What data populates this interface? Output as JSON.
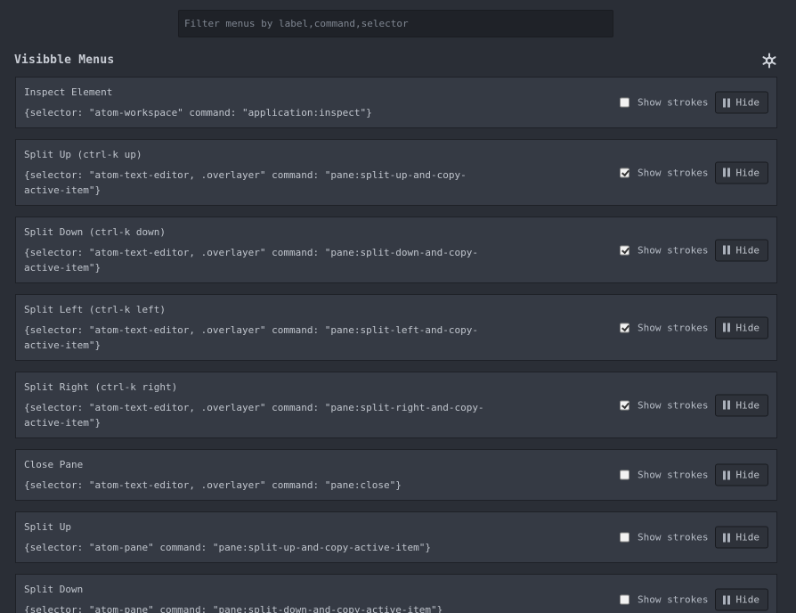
{
  "filter": {
    "placeholder": "Filter menus by label,command,selector",
    "value": ""
  },
  "section": {
    "title": "Visibble Menus",
    "settings_icon": "gear-icon"
  },
  "controls": {
    "show_strokes_label": "Show strokes",
    "hide_label": "Hide",
    "hide_icon": "pause-icon"
  },
  "menus": [
    {
      "label": "Inspect Element",
      "desc": "{selector: \"atom-workspace\" command: \"application:inspect\"}",
      "show_strokes": false
    },
    {
      "label": "Split Up (ctrl-k up)",
      "desc": "{selector: \"atom-text-editor, .overlayer\" command: \"pane:split-up-and-copy-\nactive-item\"}",
      "show_strokes": true
    },
    {
      "label": "Split Down (ctrl-k down)",
      "desc": "{selector: \"atom-text-editor, .overlayer\" command: \"pane:split-down-and-copy-\nactive-item\"}",
      "show_strokes": true
    },
    {
      "label": "Split Left (ctrl-k left)",
      "desc": "{selector: \"atom-text-editor, .overlayer\" command: \"pane:split-left-and-copy-\nactive-item\"}",
      "show_strokes": true
    },
    {
      "label": "Split Right (ctrl-k right)",
      "desc": "{selector: \"atom-text-editor, .overlayer\" command: \"pane:split-right-and-copy-\nactive-item\"}",
      "show_strokes": true
    },
    {
      "label": "Close Pane",
      "desc": "{selector: \"atom-text-editor, .overlayer\" command: \"pane:close\"}",
      "show_strokes": false
    },
    {
      "label": "Split Up",
      "desc": "{selector: \"atom-pane\" command: \"pane:split-up-and-copy-active-item\"}",
      "show_strokes": false
    },
    {
      "label": "Split Down",
      "desc": "{selector: \"atom-pane\" command: \"pane:split-down-and-copy-active-item\"}",
      "show_strokes": false
    }
  ]
}
